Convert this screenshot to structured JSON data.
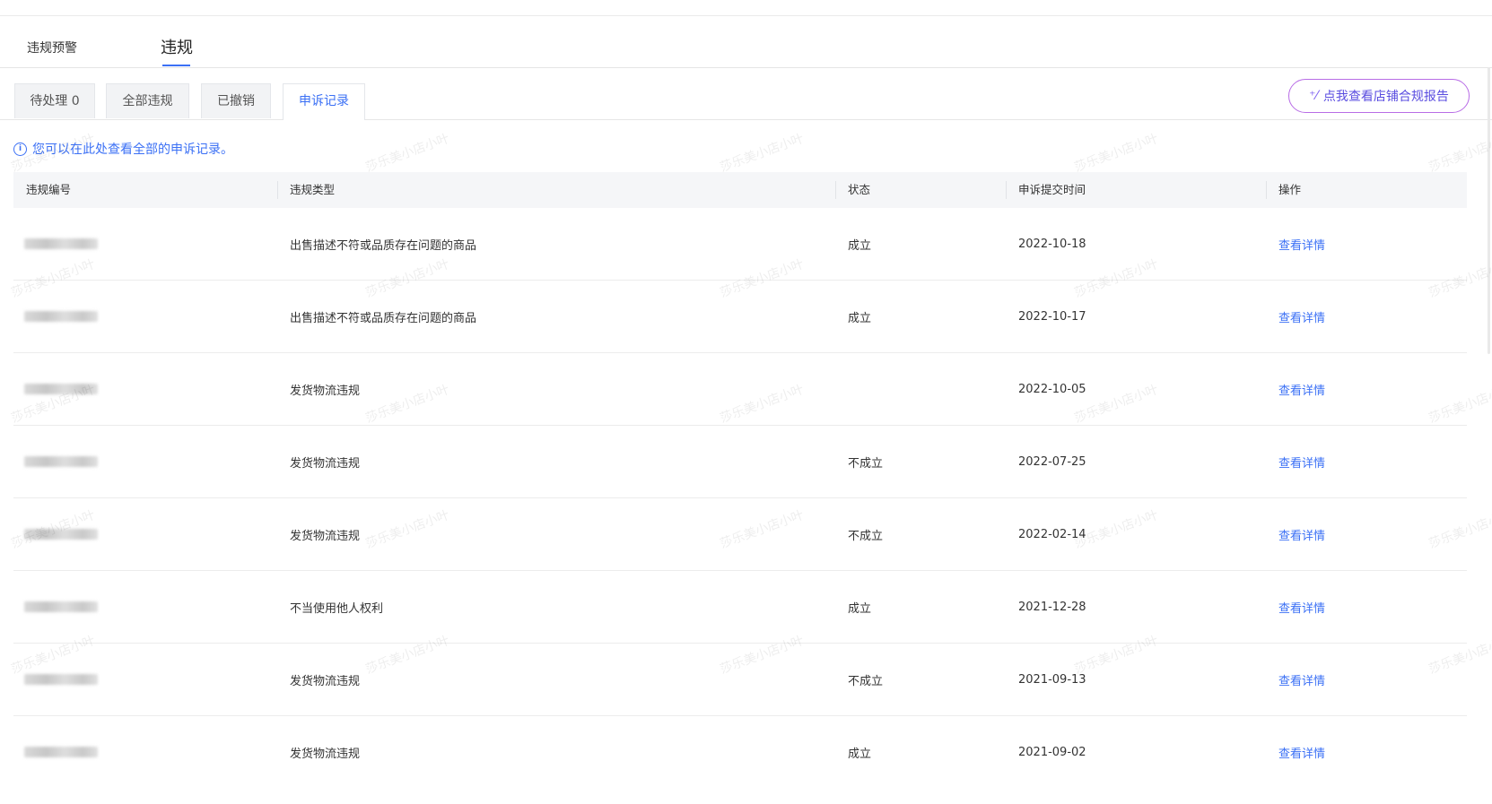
{
  "main_tabs": [
    {
      "label": "违规预警"
    },
    {
      "label": "违规"
    }
  ],
  "sub_tabs": [
    {
      "label": "待处理 0"
    },
    {
      "label": "全部违规"
    },
    {
      "label": "已撤销"
    },
    {
      "label": "申诉记录"
    }
  ],
  "report_button": {
    "icon": "sparkle-icon",
    "label": "点我查看店铺合规报告"
  },
  "info": {
    "text": "您可以在此处查看全部的申诉记录。"
  },
  "table": {
    "columns": [
      "违规编号",
      "违规类型",
      "状态",
      "申诉提交时间",
      "操作"
    ],
    "rows": [
      {
        "type": "出售描述不符或品质存在问题的商品",
        "status": "成立",
        "date": "2022-10-18",
        "action": "查看详情"
      },
      {
        "type": "出售描述不符或品质存在问题的商品",
        "status": "成立",
        "date": "2022-10-17",
        "action": "查看详情"
      },
      {
        "type": "发货物流违规",
        "status": "",
        "date": "2022-10-05",
        "action": "查看详情"
      },
      {
        "type": "发货物流违规",
        "status": "不成立",
        "date": "2022-07-25",
        "action": "查看详情"
      },
      {
        "type": "发货物流违规",
        "status": "不成立",
        "date": "2022-02-14",
        "action": "查看详情"
      },
      {
        "type": "不当使用他人权利",
        "status": "成立",
        "date": "2021-12-28",
        "action": "查看详情"
      },
      {
        "type": "发货物流违规",
        "status": "不成立",
        "date": "2021-09-13",
        "action": "查看详情"
      },
      {
        "type": "发货物流违规",
        "status": "成立",
        "date": "2021-09-02",
        "action": "查看详情"
      }
    ]
  },
  "watermark": "莎乐美小店小叶",
  "colors": {
    "accent": "#3b70f5",
    "report_border": "#b86ce6"
  }
}
